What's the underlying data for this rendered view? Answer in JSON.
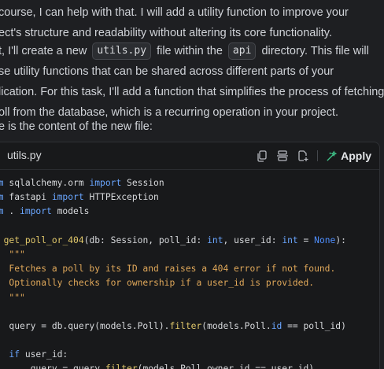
{
  "message": {
    "p1": {
      "line1": "course, I can help with that. I will add a utility function to improve your",
      "line2": "ect's structure and readability without altering its core functionality."
    },
    "p2": {
      "l1_before": "t, I'll create a new",
      "l1_code1": "utils.py",
      "l1_mid": "file within the",
      "l1_code2": "api",
      "l1_after": "directory. This file will",
      "line2": "se utility functions that can be shared across different parts of your",
      "line3": "lication. For this task, I'll add a function that simplifies the process of fetching",
      "line4": "oll from the database, which is a recurring operation in your project."
    },
    "p3": "e is the content of the new file:"
  },
  "code_block": {
    "filename": "utils.py",
    "apply_label": "Apply",
    "lines": [
      [
        [
          "kw",
          "om"
        ],
        [
          "t",
          " sqlalchemy.orm "
        ],
        [
          "kw",
          "import"
        ],
        [
          "t",
          " Session"
        ]
      ],
      [
        [
          "kw",
          "om"
        ],
        [
          "t",
          " fastapi "
        ],
        [
          "kw",
          "import"
        ],
        [
          "t",
          " HTTPException"
        ]
      ],
      [
        [
          "kw",
          "om"
        ],
        [
          "t",
          " . "
        ],
        [
          "kw",
          "import"
        ],
        [
          "t",
          " models"
        ]
      ],
      [],
      [
        [
          "kw",
          "f"
        ],
        [
          "t",
          " "
        ],
        [
          "fn",
          "get_poll_or_404"
        ],
        [
          "t",
          "(db: Session, poll_id: "
        ],
        [
          "kw",
          "int"
        ],
        [
          "t",
          ", user_id: "
        ],
        [
          "kw",
          "int"
        ],
        [
          "t",
          " = "
        ],
        [
          "none",
          "None"
        ],
        [
          "t",
          "):"
        ]
      ],
      [
        [
          "doc",
          "   \"\"\""
        ]
      ],
      [
        [
          "doc",
          "   Fetches a poll by its ID and raises a 404 error if not found."
        ]
      ],
      [
        [
          "doc",
          "   Optionally checks for ownership if a user_id is provided."
        ]
      ],
      [
        [
          "doc",
          "   \"\"\""
        ]
      ],
      [],
      [
        [
          "t",
          "   query = db.query(models.Poll)."
        ],
        [
          "fn",
          "filter"
        ],
        [
          "t",
          "(models.Poll."
        ],
        [
          "kw",
          "id"
        ],
        [
          "t",
          " == poll_id)"
        ]
      ],
      [],
      [
        [
          "kw",
          "   if"
        ],
        [
          "t",
          " user_id:"
        ]
      ],
      [
        [
          "t",
          "       query = query."
        ],
        [
          "fn",
          "filter"
        ],
        [
          "t",
          "(models.Poll.owner_id == user_id)"
        ]
      ]
    ]
  },
  "icons": [
    "copy-icon",
    "diff-icon",
    "insert-file-icon",
    "apply-sparkle-icon"
  ],
  "colors": {
    "background": "#1e1f22",
    "code_background": "#18191b",
    "keyword": "#6aa6ff",
    "function": "#e2c96b",
    "docstring": "#e0a85a"
  }
}
